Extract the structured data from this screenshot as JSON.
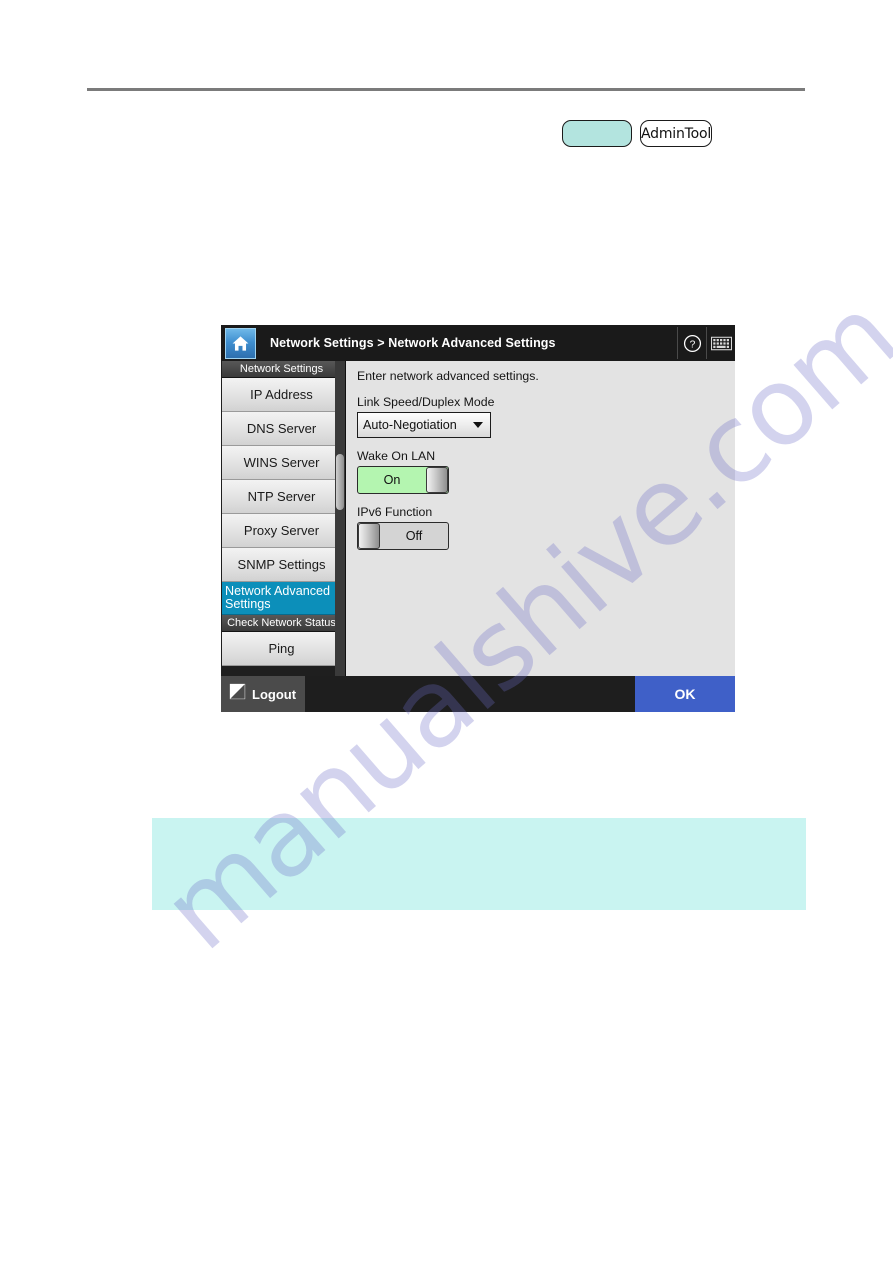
{
  "page": {
    "watermark_text": "manualshive.com"
  },
  "badges": {
    "blank_label": "",
    "admin_label": "AdminTool"
  },
  "device": {
    "header": {
      "home_icon": "home-icon",
      "breadcrumb": "Network Settings  >  Network Advanced Settings",
      "help_icon": "question-mark-icon",
      "keyboard_icon": "keyboard-icon"
    },
    "sidebar": {
      "sections": [
        {
          "title": "Network Settings",
          "items": [
            {
              "label": "IP Address",
              "selected": false
            },
            {
              "label": "DNS Server",
              "selected": false
            },
            {
              "label": "WINS Server",
              "selected": false
            },
            {
              "label": "NTP Server",
              "selected": false
            },
            {
              "label": "Proxy Server",
              "selected": false
            },
            {
              "label": "SNMP Settings",
              "selected": false
            },
            {
              "label": "Network Advanced Settings",
              "selected": true
            }
          ]
        },
        {
          "title": "Check Network Status",
          "items": [
            {
              "label": "Ping",
              "selected": false
            }
          ]
        }
      ]
    },
    "content": {
      "description": "Enter network advanced settings.",
      "fields": [
        {
          "label": "Link Speed/Duplex Mode",
          "type": "select",
          "value": "Auto-Negotiation"
        },
        {
          "label": "Wake On LAN",
          "type": "toggle",
          "value": "On",
          "state": "on"
        },
        {
          "label": "IPv6 Function",
          "type": "toggle",
          "value": "Off",
          "state": "off"
        }
      ]
    },
    "footer": {
      "logout_label": "Logout",
      "logout_icon": "logout-icon",
      "ok_label": "OK"
    }
  },
  "note": {
    "text": ""
  },
  "colors": {
    "selected_item": "#0c8fba",
    "ok_button": "#3f60c8",
    "toggle_on": "#b4f5b0",
    "toggle_off": "#d4d4d4",
    "note_background": "#c9f4f1",
    "badge_fill": "#b3e4df"
  }
}
